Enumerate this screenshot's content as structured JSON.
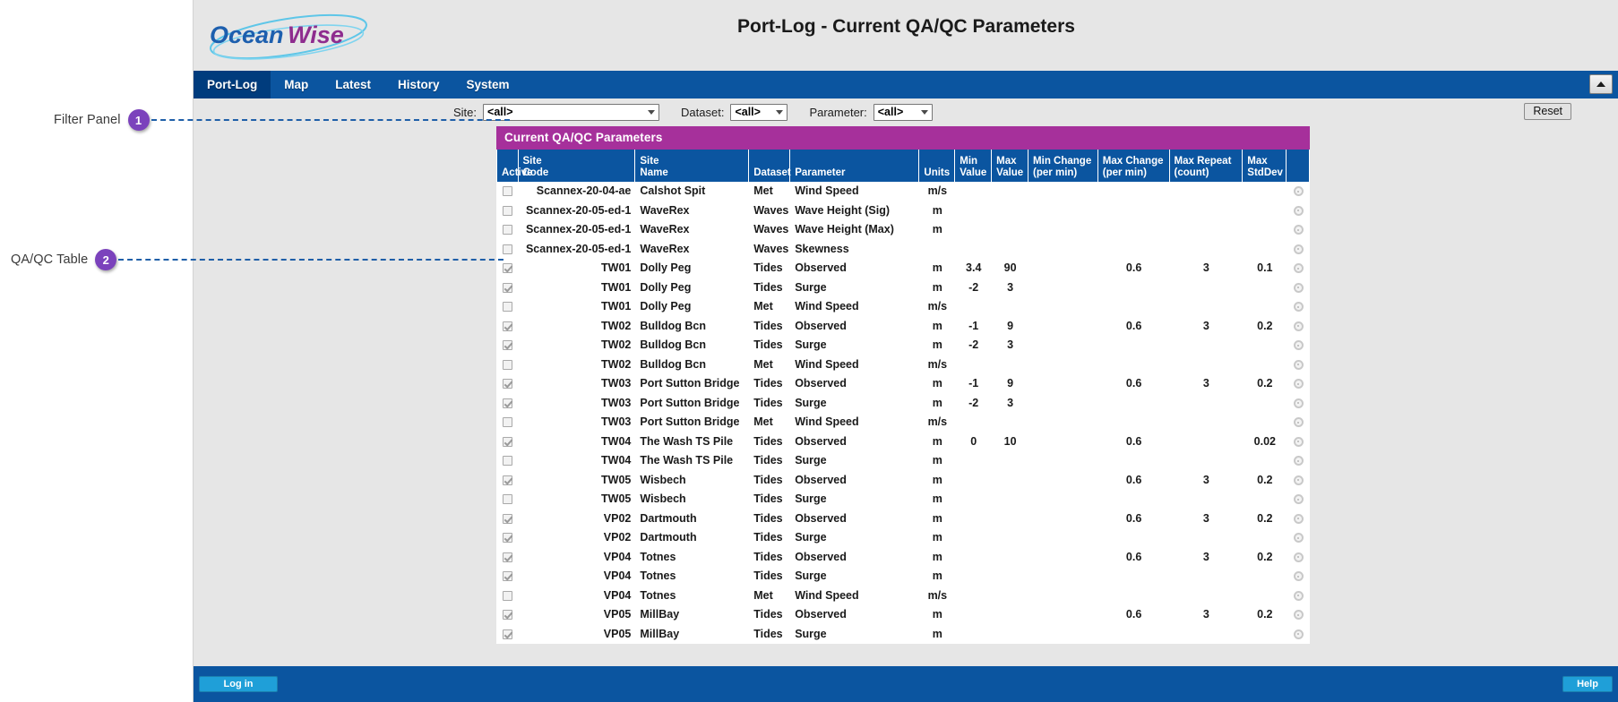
{
  "page": {
    "title": "Port-Log - Current QA/QC Parameters",
    "brand": "OceanWise"
  },
  "annotations": [
    {
      "label": "Filter Panel",
      "number": "1"
    },
    {
      "label": "QA/QC Table",
      "number": "2"
    }
  ],
  "nav": {
    "items": [
      {
        "label": "Port-Log",
        "active": true
      },
      {
        "label": "Map",
        "active": false
      },
      {
        "label": "Latest",
        "active": false
      },
      {
        "label": "History",
        "active": false
      },
      {
        "label": "System",
        "active": false
      }
    ],
    "collapse_icon": "triangle-up-icon"
  },
  "filters": {
    "site_label": "Site:",
    "site_value": "<all>",
    "dataset_label": "Dataset:",
    "dataset_value": "<all>",
    "parameter_label": "Parameter:",
    "parameter_value": "<all>",
    "reset_label": "Reset"
  },
  "panel": {
    "heading": "Current QA/QC Parameters",
    "accent_color": "#a6309b",
    "header_color": "#0b55a0"
  },
  "table": {
    "columns": [
      "Active",
      "Site\nCode",
      "Site\nName",
      "Dataset",
      "Parameter",
      "Units",
      "Min\nValue",
      "Max\nValue",
      "Min Change\n(per min)",
      "Max Change\n(per min)",
      "Max Repeat\n(count)",
      "Max\nStdDev",
      ""
    ],
    "columns_split": [
      {
        "l1": "",
        "l2": "Active"
      },
      {
        "l1": "Site",
        "l2": "Code"
      },
      {
        "l1": "Site",
        "l2": "Name"
      },
      {
        "l1": "",
        "l2": "Dataset"
      },
      {
        "l1": "",
        "l2": "Parameter"
      },
      {
        "l1": "",
        "l2": "Units"
      },
      {
        "l1": "Min",
        "l2": "Value"
      },
      {
        "l1": "Max",
        "l2": "Value"
      },
      {
        "l1": "Min Change",
        "l2": "(per min)"
      },
      {
        "l1": "Max Change",
        "l2": "(per min)"
      },
      {
        "l1": "Max Repeat",
        "l2": "(count)"
      },
      {
        "l1": "Max",
        "l2": "StdDev"
      },
      {
        "l1": "",
        "l2": ""
      }
    ],
    "rows": [
      {
        "active": false,
        "site_code": "Scannex-20-04-ae",
        "site_name": "Calshot Spit",
        "dataset": "Met",
        "parameter": "Wind Speed",
        "units": "m/s",
        "min_value": "",
        "max_value": "",
        "min_change": "",
        "max_change": "",
        "max_repeat": "",
        "max_stddev": ""
      },
      {
        "active": false,
        "site_code": "Scannex-20-05-ed-1",
        "site_name": "WaveRex",
        "dataset": "Waves",
        "parameter": "Wave Height (Sig)",
        "units": "m",
        "min_value": "",
        "max_value": "",
        "min_change": "",
        "max_change": "",
        "max_repeat": "",
        "max_stddev": ""
      },
      {
        "active": false,
        "site_code": "Scannex-20-05-ed-1",
        "site_name": "WaveRex",
        "dataset": "Waves",
        "parameter": "Wave Height (Max)",
        "units": "m",
        "min_value": "",
        "max_value": "",
        "min_change": "",
        "max_change": "",
        "max_repeat": "",
        "max_stddev": ""
      },
      {
        "active": false,
        "site_code": "Scannex-20-05-ed-1",
        "site_name": "WaveRex",
        "dataset": "Waves",
        "parameter": "Skewness",
        "units": "",
        "min_value": "",
        "max_value": "",
        "min_change": "",
        "max_change": "",
        "max_repeat": "",
        "max_stddev": ""
      },
      {
        "active": true,
        "site_code": "TW01",
        "site_name": "Dolly Peg",
        "dataset": "Tides",
        "parameter": "Observed",
        "units": "m",
        "min_value": "3.4",
        "max_value": "90",
        "min_change": "",
        "max_change": "0.6",
        "max_repeat": "3",
        "max_stddev": "0.1"
      },
      {
        "active": true,
        "site_code": "TW01",
        "site_name": "Dolly Peg",
        "dataset": "Tides",
        "parameter": "Surge",
        "units": "m",
        "min_value": "-2",
        "max_value": "3",
        "min_change": "",
        "max_change": "",
        "max_repeat": "",
        "max_stddev": ""
      },
      {
        "active": false,
        "site_code": "TW01",
        "site_name": "Dolly Peg",
        "dataset": "Met",
        "parameter": "Wind Speed",
        "units": "m/s",
        "min_value": "",
        "max_value": "",
        "min_change": "",
        "max_change": "",
        "max_repeat": "",
        "max_stddev": ""
      },
      {
        "active": true,
        "site_code": "TW02",
        "site_name": "Bulldog Bcn",
        "dataset": "Tides",
        "parameter": "Observed",
        "units": "m",
        "min_value": "-1",
        "max_value": "9",
        "min_change": "",
        "max_change": "0.6",
        "max_repeat": "3",
        "max_stddev": "0.2"
      },
      {
        "active": true,
        "site_code": "TW02",
        "site_name": "Bulldog Bcn",
        "dataset": "Tides",
        "parameter": "Surge",
        "units": "m",
        "min_value": "-2",
        "max_value": "3",
        "min_change": "",
        "max_change": "",
        "max_repeat": "",
        "max_stddev": ""
      },
      {
        "active": false,
        "site_code": "TW02",
        "site_name": "Bulldog Bcn",
        "dataset": "Met",
        "parameter": "Wind Speed",
        "units": "m/s",
        "min_value": "",
        "max_value": "",
        "min_change": "",
        "max_change": "",
        "max_repeat": "",
        "max_stddev": ""
      },
      {
        "active": true,
        "site_code": "TW03",
        "site_name": "Port Sutton Bridge",
        "dataset": "Tides",
        "parameter": "Observed",
        "units": "m",
        "min_value": "-1",
        "max_value": "9",
        "min_change": "",
        "max_change": "0.6",
        "max_repeat": "3",
        "max_stddev": "0.2"
      },
      {
        "active": true,
        "site_code": "TW03",
        "site_name": "Port Sutton Bridge",
        "dataset": "Tides",
        "parameter": "Surge",
        "units": "m",
        "min_value": "-2",
        "max_value": "3",
        "min_change": "",
        "max_change": "",
        "max_repeat": "",
        "max_stddev": ""
      },
      {
        "active": false,
        "site_code": "TW03",
        "site_name": "Port Sutton Bridge",
        "dataset": "Met",
        "parameter": "Wind Speed",
        "units": "m/s",
        "min_value": "",
        "max_value": "",
        "min_change": "",
        "max_change": "",
        "max_repeat": "",
        "max_stddev": ""
      },
      {
        "active": true,
        "site_code": "TW04",
        "site_name": "The Wash TS Pile",
        "dataset": "Tides",
        "parameter": "Observed",
        "units": "m",
        "min_value": "0",
        "max_value": "10",
        "min_change": "",
        "max_change": "0.6",
        "max_repeat": "",
        "max_stddev": "0.02"
      },
      {
        "active": false,
        "site_code": "TW04",
        "site_name": "The Wash TS Pile",
        "dataset": "Tides",
        "parameter": "Surge",
        "units": "m",
        "min_value": "",
        "max_value": "",
        "min_change": "",
        "max_change": "",
        "max_repeat": "",
        "max_stddev": ""
      },
      {
        "active": true,
        "site_code": "TW05",
        "site_name": "Wisbech",
        "dataset": "Tides",
        "parameter": "Observed",
        "units": "m",
        "min_value": "",
        "max_value": "",
        "min_change": "",
        "max_change": "0.6",
        "max_repeat": "3",
        "max_stddev": "0.2"
      },
      {
        "active": false,
        "site_code": "TW05",
        "site_name": "Wisbech",
        "dataset": "Tides",
        "parameter": "Surge",
        "units": "m",
        "min_value": "",
        "max_value": "",
        "min_change": "",
        "max_change": "",
        "max_repeat": "",
        "max_stddev": ""
      },
      {
        "active": true,
        "site_code": "VP02",
        "site_name": "Dartmouth",
        "dataset": "Tides",
        "parameter": "Observed",
        "units": "m",
        "min_value": "",
        "max_value": "",
        "min_change": "",
        "max_change": "0.6",
        "max_repeat": "3",
        "max_stddev": "0.2"
      },
      {
        "active": true,
        "site_code": "VP02",
        "site_name": "Dartmouth",
        "dataset": "Tides",
        "parameter": "Surge",
        "units": "m",
        "min_value": "",
        "max_value": "",
        "min_change": "",
        "max_change": "",
        "max_repeat": "",
        "max_stddev": ""
      },
      {
        "active": true,
        "site_code": "VP04",
        "site_name": "Totnes",
        "dataset": "Tides",
        "parameter": "Observed",
        "units": "m",
        "min_value": "",
        "max_value": "",
        "min_change": "",
        "max_change": "0.6",
        "max_repeat": "3",
        "max_stddev": "0.2"
      },
      {
        "active": true,
        "site_code": "VP04",
        "site_name": "Totnes",
        "dataset": "Tides",
        "parameter": "Surge",
        "units": "m",
        "min_value": "",
        "max_value": "",
        "min_change": "",
        "max_change": "",
        "max_repeat": "",
        "max_stddev": ""
      },
      {
        "active": false,
        "site_code": "VP04",
        "site_name": "Totnes",
        "dataset": "Met",
        "parameter": "Wind Speed",
        "units": "m/s",
        "min_value": "",
        "max_value": "",
        "min_change": "",
        "max_change": "",
        "max_repeat": "",
        "max_stddev": ""
      },
      {
        "active": true,
        "site_code": "VP05",
        "site_name": "MillBay",
        "dataset": "Tides",
        "parameter": "Observed",
        "units": "m",
        "min_value": "",
        "max_value": "",
        "min_change": "",
        "max_change": "0.6",
        "max_repeat": "3",
        "max_stddev": "0.2"
      },
      {
        "active": true,
        "site_code": "VP05",
        "site_name": "MillBay",
        "dataset": "Tides",
        "parameter": "Surge",
        "units": "m",
        "min_value": "",
        "max_value": "",
        "min_change": "",
        "max_change": "",
        "max_repeat": "",
        "max_stddev": ""
      }
    ],
    "row_action_icon": "gear-icon"
  },
  "footer": {
    "login_label": "Log in",
    "help_label": "Help"
  }
}
